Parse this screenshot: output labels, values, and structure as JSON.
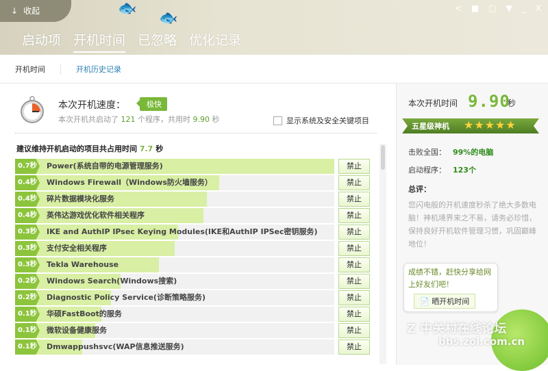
{
  "header": {
    "collapse_label": "收起",
    "tabs": [
      "启动项",
      "开机时间",
      "已忽略",
      "优化记录"
    ],
    "active_tab": 1,
    "window_buttons": [
      "share-icon",
      "skin-icon",
      "mini-icon",
      "menu-icon",
      "minimize-icon",
      "close-icon"
    ]
  },
  "subnav": {
    "items": [
      "开机时间",
      "开机历史记录"
    ]
  },
  "speed": {
    "label": "本次开机速度：",
    "badge": "极快",
    "summary_pre": "本次开机共启动了",
    "count": "121",
    "summary_mid": "个程序，共用时",
    "time": "9.90",
    "summary_unit": "秒",
    "checkbox_label": "显示系统及安全关键项目"
  },
  "list": {
    "title_pre": "建议维持开机启动的项目共占用时间",
    "total": "7.7",
    "title_unit": "秒",
    "button_label": "禁止",
    "items": [
      {
        "time": "0.7秒",
        "name": "Power(系统自带的电源管理服务)",
        "fill": 100
      },
      {
        "time": "0.4秒",
        "name": "Windows Firewall（Windows防火墙服务）",
        "fill": 64
      },
      {
        "time": "0.4秒",
        "name": "碎片数据模块化服务",
        "fill": 60
      },
      {
        "time": "0.4秒",
        "name": "英伟达游戏优化软件相关程序",
        "fill": 59
      },
      {
        "time": "0.3秒",
        "name": "IKE and AuthIP IPsec Keying Modules(IKE和AuthIP IPSec密钥服务)",
        "fill": 51
      },
      {
        "time": "0.3秒",
        "name": "支付安全相关程序",
        "fill": 50
      },
      {
        "time": "0.3秒",
        "name": "Tekla Warehouse",
        "fill": 45
      },
      {
        "time": "0.2秒",
        "name": "Windows Search(Windows搜索)",
        "fill": 33
      },
      {
        "time": "0.2秒",
        "name": "Diagnostic Policy Service(诊断策略服务)",
        "fill": 30
      },
      {
        "time": "0.1秒",
        "name": "华硕FastBoot的服务",
        "fill": 27
      },
      {
        "time": "0.1秒",
        "name": "微软设备健康服务",
        "fill": 25
      },
      {
        "time": "0.1秒",
        "name": "Dmwappushsvc(WAP信息推送服务)",
        "fill": 21
      }
    ]
  },
  "side": {
    "boot_label": "本次开机时间",
    "boot_time": "9.90",
    "boot_unit": "秒",
    "rank": "五星级神机",
    "stars": "★★★★★",
    "beat_label": "击败全国：",
    "beat_value": "99%的电脑",
    "programs_label": "启动程序：",
    "programs_value": "123个",
    "review_label": "总评：",
    "review_text": "您闪电般的开机速度秒杀了绝大多数电脑！神机境界来之不易，请务必珍惜，保持良好开机软件管理习惯，巩固巅峰地位！",
    "bubble_text": "成绩不错，赶快分享给网上好友们吧！",
    "share_label": "晒开机时间"
  },
  "watermark": {
    "line1": "中关村在线论坛",
    "line2": "bbs.zol.com.cn"
  }
}
